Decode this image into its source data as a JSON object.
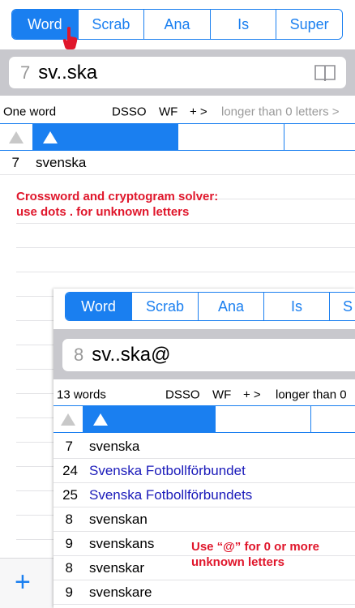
{
  "main": {
    "tabs": [
      {
        "label": "Word",
        "active": true
      },
      {
        "label": "Scrab",
        "active": false
      },
      {
        "label": "Ana",
        "active": false
      },
      {
        "label": "Is",
        "active": false
      },
      {
        "label": "Super",
        "active": false
      }
    ],
    "search": {
      "count": "7",
      "query": "sv..ska"
    },
    "info": {
      "result_count": "One word",
      "dict": "DSSO",
      "wf": "WF",
      "plus_more": "+ >",
      "length_filter": "longer than 0 letters >"
    },
    "results": [
      {
        "num": "7",
        "word": "svenska"
      }
    ],
    "annotation": "Crossword and cryptogram solver:\nuse dots . for unknown letters",
    "add_button": "+"
  },
  "overlay": {
    "tabs": [
      {
        "label": "Word",
        "active": true
      },
      {
        "label": "Scrab",
        "active": false
      },
      {
        "label": "Ana",
        "active": false
      },
      {
        "label": "Is",
        "active": false
      },
      {
        "label": "S",
        "active": false
      }
    ],
    "search": {
      "count": "8",
      "query": "sv..ska@"
    },
    "info": {
      "result_count": "13 words",
      "dict": "DSSO",
      "wf": "WF",
      "plus_more": "+ >",
      "length_filter": "longer than 0"
    },
    "results": [
      {
        "num": "7",
        "word": "svenska",
        "link": false
      },
      {
        "num": "24",
        "word": "Svenska Fotbollförbundet",
        "link": true
      },
      {
        "num": "25",
        "word": "Svenska Fotbollförbundets",
        "link": true
      },
      {
        "num": "8",
        "word": "svenskan",
        "link": false
      },
      {
        "num": "9",
        "word": "svenskans",
        "link": false
      },
      {
        "num": "8",
        "word": "svenskar",
        "link": false
      },
      {
        "num": "9",
        "word": "svenskare",
        "link": false
      }
    ],
    "annotation": "Use “@” for 0 or more\nunknown letters"
  },
  "colors": {
    "accent": "#1a7ff0",
    "annotation": "#e0162b",
    "link": "#1a1aba"
  }
}
